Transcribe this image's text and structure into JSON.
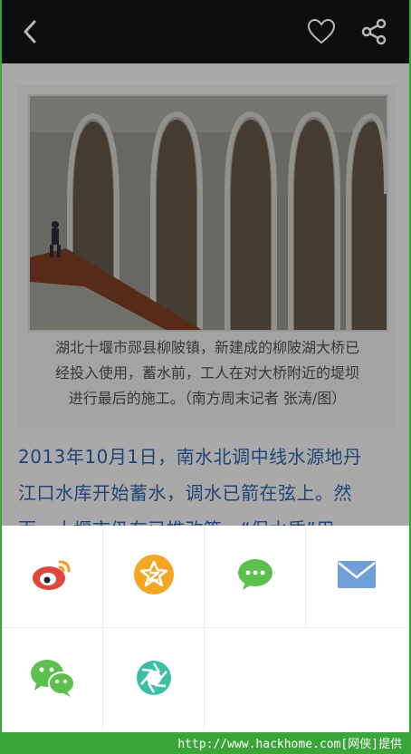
{
  "nav": {
    "back_icon": "back-arrow-icon",
    "favorite_icon": "heart-icon",
    "share_icon": "share-icon"
  },
  "article": {
    "photo_caption_lines": [
      "湖北十堰市郧县柳陂镇，新建成的柳陂湖大桥已",
      "经投入使用，蓄水前，工人在对大桥附近的堤坝",
      "进行最后的施工。（南方周末记者 张涛/图）"
    ],
    "body_lines": [
      "2013年10月1日，南水北调中线水源地丹",
      "江口水库开始蓄水，调水已箭在弦上。然",
      "而，十堰市仍在已推改策，“保水质”用"
    ]
  },
  "share_sheet": {
    "items": [
      {
        "name": "weibo",
        "icon": "sina-weibo-icon",
        "color": "#e0463c"
      },
      {
        "name": "qzone",
        "icon": "qzone-icon",
        "color": "#f5a623"
      },
      {
        "name": "sms",
        "icon": "message-icon",
        "color": "#5dbf4d"
      },
      {
        "name": "email",
        "icon": "mail-icon",
        "color": "#6f9fd8"
      },
      {
        "name": "wechat",
        "icon": "wechat-icon",
        "color": "#5dbf4d"
      },
      {
        "name": "moments",
        "icon": "moments-icon",
        "color": "#3bbfa6"
      }
    ]
  },
  "footer": {
    "watermark": "http://www.hackhome.com[网侠]提供"
  }
}
